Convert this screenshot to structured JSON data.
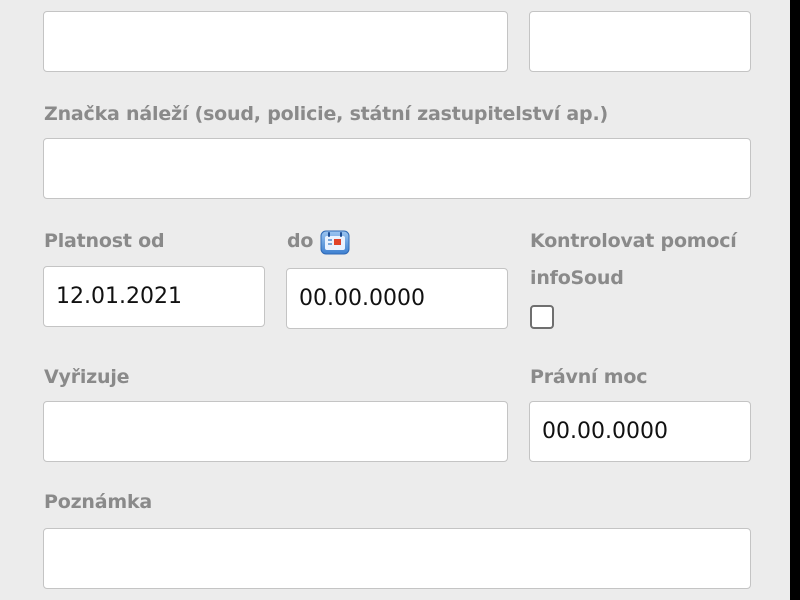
{
  "form": {
    "top_left_field": {
      "value": ""
    },
    "top_right_field": {
      "value": ""
    },
    "znacka_nalezi": {
      "label": "Značka náleží (soud, policie, státní zastupitelství ap.)",
      "value": ""
    },
    "platnost_od": {
      "label": "Platnost od",
      "value": "12.01.2021"
    },
    "platnost_do": {
      "label": "do",
      "value": "00.00.0000",
      "icon": "calendar-icon"
    },
    "kontrolovat": {
      "label_line1": "Kontrolovat pomocí",
      "label_line2": "infoSoud",
      "checked": false
    },
    "vyrizuje": {
      "label": "Vyřizuje",
      "value": ""
    },
    "pravni_moc": {
      "label": "Právní moc",
      "value": "00.00.0000"
    },
    "poznamka": {
      "label": "Poznámka",
      "value": ""
    }
  },
  "colors": {
    "background": "#ececec",
    "label": "#8a8a8a",
    "input_border": "#c4c4c4"
  }
}
